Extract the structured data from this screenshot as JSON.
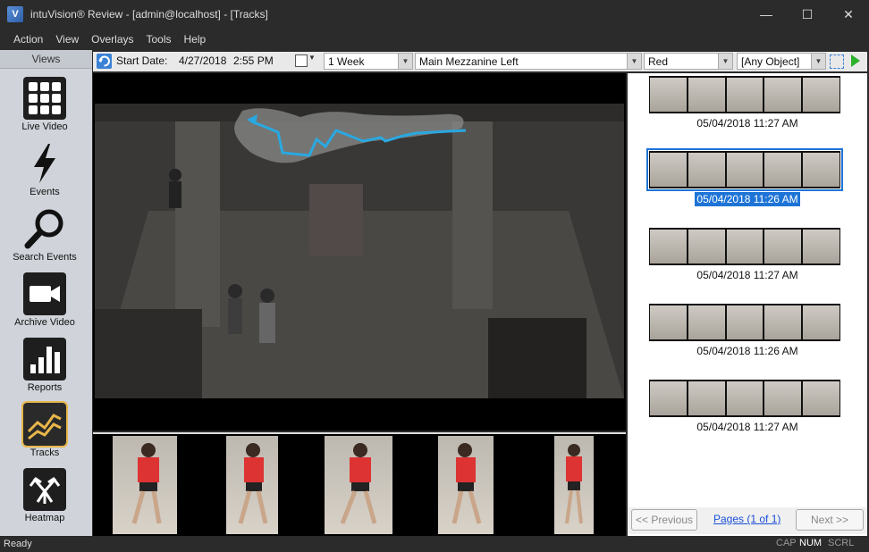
{
  "window": {
    "title": "intuVision® Review - [admin@localhost] - [Tracks]",
    "minimize": "—",
    "maximize": "☐",
    "close": "✕"
  },
  "menu": [
    "Action",
    "View",
    "Overlays",
    "Tools",
    "Help"
  ],
  "views": {
    "header": "Views",
    "items": [
      {
        "label": "Live Video",
        "icon": "grid-icon"
      },
      {
        "label": "Events",
        "icon": "lightning-icon"
      },
      {
        "label": "Search Events",
        "icon": "search-icon"
      },
      {
        "label": "Archive Video",
        "icon": "video-camera-icon"
      },
      {
        "label": "Reports",
        "icon": "bar-chart-icon"
      },
      {
        "label": "Tracks",
        "icon": "tracks-icon"
      },
      {
        "label": "Heatmap",
        "icon": "heatmap-icon"
      }
    ],
    "active": "Tracks"
  },
  "toolbar": {
    "start_date_label": "Start Date:",
    "start_date": "4/27/2018",
    "start_time": "2:55 PM",
    "period": "1 Week",
    "camera": "Main Mezzanine Left",
    "color": "Red",
    "object": "[Any Object]"
  },
  "tracks": [
    {
      "time": "05/04/2018 11:27 AM",
      "selected": false
    },
    {
      "time": "05/04/2018 11:26 AM",
      "selected": true
    },
    {
      "time": "05/04/2018 11:27 AM",
      "selected": false
    },
    {
      "time": "05/04/2018 11:26 AM",
      "selected": false
    },
    {
      "time": "05/04/2018 11:27 AM",
      "selected": false
    }
  ],
  "pager": {
    "prev": "<< Previous",
    "pages": "Pages (1 of 1)",
    "next": "Next >>"
  },
  "status": {
    "text": "Ready",
    "cap": "CAP",
    "num": "NUM",
    "scrl": "SCRL"
  },
  "colors": {
    "accent": "#1e74d6",
    "track_path": "#2aa8e0",
    "active_view_border": "#e8b64a"
  }
}
